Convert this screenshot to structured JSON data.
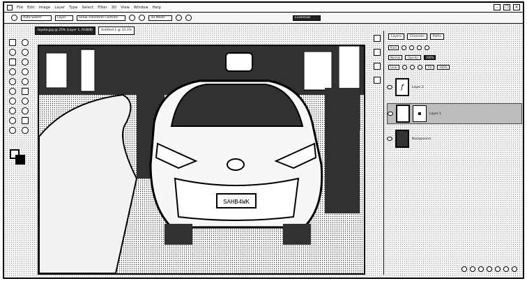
{
  "window": {
    "menu": [
      "File",
      "Edit",
      "Image",
      "Layer",
      "Type",
      "Select",
      "Filter",
      "3D",
      "View",
      "Window",
      "Help"
    ],
    "controls": [
      "–",
      "❐",
      "✕"
    ]
  },
  "options_bar": {
    "items": [
      "Auto-Select:",
      "Layer",
      "Show Transform Controls",
      "3D Mode:",
      "Essentials"
    ]
  },
  "document": {
    "tabs": [
      "toyota.jpg @ 25% (Layer 1, RGB/8)",
      "Untitled-1 @ 33.3%"
    ],
    "plate_text": "SAHB4WK"
  },
  "layers_panel": {
    "tabs": [
      "Layers",
      "Channels",
      "Paths"
    ],
    "kind_label": "Kind",
    "blend_mode": "Normal",
    "opacity_label": "Opacity:",
    "opacity_value": "100%",
    "lock_label": "Lock:",
    "fill_label": "Fill:",
    "fill_value": "100%",
    "layers": [
      {
        "name": "Layer 2",
        "thumb": "f"
      },
      {
        "name": "Layer 1",
        "thumb": "",
        "mask": "▪"
      },
      {
        "name": "Background",
        "thumb": ""
      }
    ]
  },
  "colors": {
    "foreground": "#ffffff",
    "background": "#000000",
    "accent": "#222222"
  }
}
